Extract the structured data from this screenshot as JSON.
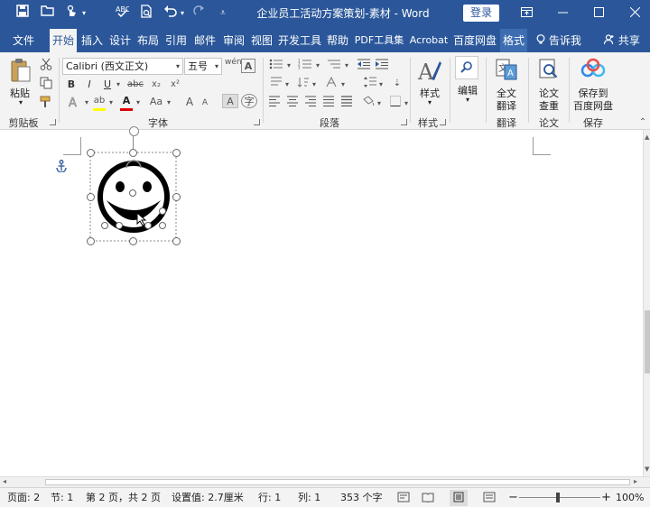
{
  "window": {
    "title": "企业员工活动方案策划-素材  -  Word",
    "login_label": "登录"
  },
  "quick_access": {
    "icons": [
      "save-icon",
      "open-icon",
      "touch-mode-icon",
      "spellcheck-icon",
      "print-preview-icon",
      "undo-icon",
      "redo-icon",
      "customize-icon"
    ]
  },
  "tabs": [
    {
      "label": "文件"
    },
    {
      "label": "开始"
    },
    {
      "label": "插入"
    },
    {
      "label": "设计"
    },
    {
      "label": "布局"
    },
    {
      "label": "引用"
    },
    {
      "label": "邮件"
    },
    {
      "label": "审阅"
    },
    {
      "label": "视图"
    },
    {
      "label": "开发工具"
    },
    {
      "label": "帮助"
    },
    {
      "label": "PDF工具集"
    },
    {
      "label": "Acrobat"
    },
    {
      "label": "百度网盘"
    },
    {
      "label": "格式"
    }
  ],
  "tell_me": "告诉我",
  "share": "共享",
  "ribbon": {
    "clipboard": {
      "label": "剪贴板",
      "paste": "粘贴"
    },
    "font": {
      "label": "字体",
      "font_name": "Calibri (西文正文)",
      "font_size": "五号",
      "bold": "B",
      "italic": "I",
      "underline": "U",
      "strike": "abc",
      "subscript": "x₂",
      "superscript": "x²",
      "grow": "A",
      "shrink": "A",
      "case": "Aa",
      "color_a": "A",
      "highlight": "ab",
      "phonetic": "wén",
      "border": "A"
    },
    "paragraph": {
      "label": "段落"
    },
    "styles": {
      "label": "样式",
      "button": "样式"
    },
    "editing": {
      "button": "编辑"
    },
    "translate": {
      "label": "翻译",
      "button_line1": "全文",
      "button_line2": "翻译"
    },
    "paper": {
      "label": "论文",
      "button_line1": "论文",
      "button_line2": "查重"
    },
    "save": {
      "label": "保存",
      "button_line1": "保存到",
      "button_line2": "百度网盘"
    }
  },
  "status": {
    "page": "页面: 2",
    "section": "节: 1",
    "page_of": "第 2 页，共 2 页",
    "position": "设置值: 2.7厘米",
    "row": "行: 1",
    "col": "列: 1",
    "chars": "353 个字",
    "zoom": "100%",
    "zoom_minus": "−",
    "zoom_plus": "+"
  },
  "colors": {
    "brand": "#2b579a",
    "font_color_bar": "#e00000",
    "highlight_bar": "#ffff00"
  }
}
